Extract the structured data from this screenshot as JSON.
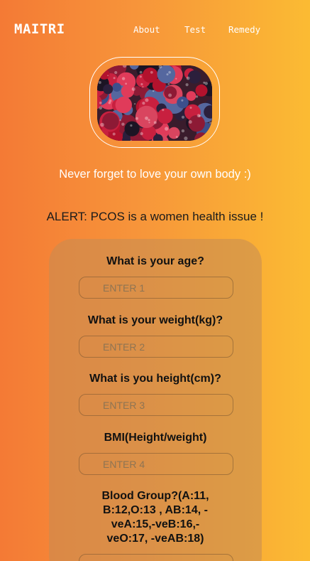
{
  "nav": {
    "brand": "MAITRI",
    "links": [
      "About",
      "Test",
      "Remedy"
    ]
  },
  "hero": {
    "image": "mixed-berries-image",
    "tagline": "Never forget to love your own body :)"
  },
  "alert": "ALERT: PCOS is a women health issue !",
  "form": {
    "questions": [
      {
        "label": "What is your age?",
        "placeholder": "ENTER 1"
      },
      {
        "label": "What is your weight(kg)?",
        "placeholder": "ENTER 2"
      },
      {
        "label": "What is you height(cm)?",
        "placeholder": "ENTER 3"
      },
      {
        "label": "BMI(Height/weight)",
        "placeholder": "ENTER 4"
      },
      {
        "label": "Blood Group?(A:11, B:12,O:13 , AB:14, -veA:15,-veB:16,-veO:17, -veAB:18)",
        "placeholder": ""
      }
    ]
  },
  "colors": {
    "gradient_start": "#f47a35",
    "gradient_end": "#fbbb33",
    "text_light": "#ffffff",
    "text_dark": "#111111"
  }
}
